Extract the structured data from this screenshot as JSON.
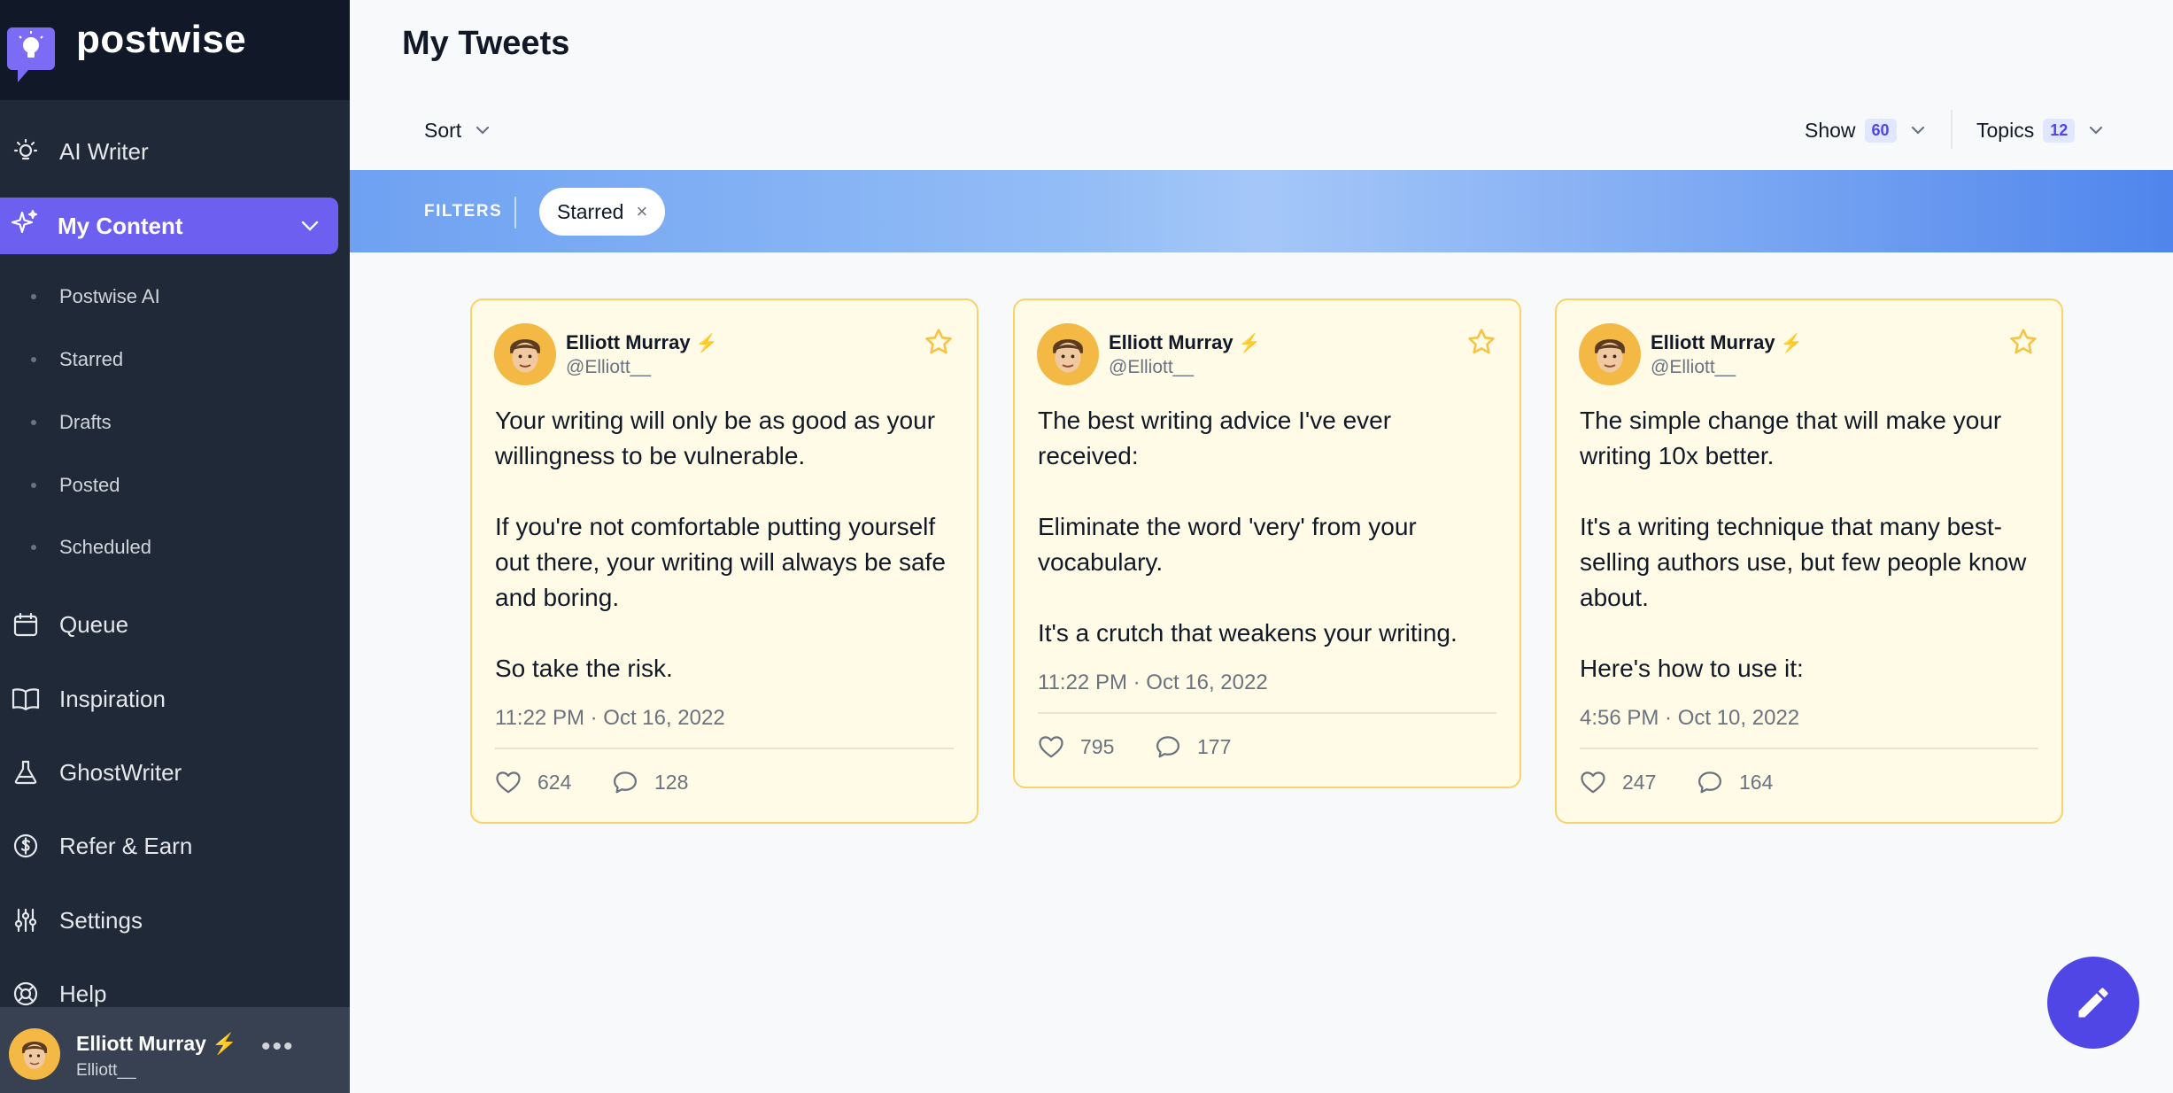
{
  "app": {
    "name": "postwise"
  },
  "sidebar": {
    "nav": [
      {
        "label": "AI Writer",
        "icon": "lightbulb-icon"
      },
      {
        "label": "My Content",
        "icon": "sparkles-icon",
        "active": true
      },
      {
        "label": "Queue",
        "icon": "calendar-icon"
      },
      {
        "label": "Inspiration",
        "icon": "book-icon"
      },
      {
        "label": "GhostWriter",
        "icon": "flask-icon"
      },
      {
        "label": "Refer & Earn",
        "icon": "dollar-icon"
      },
      {
        "label": "Settings",
        "icon": "sliders-icon"
      },
      {
        "label": "Help",
        "icon": "lifebuoy-icon"
      }
    ],
    "sub_items": [
      "Postwise AI",
      "Starred",
      "Drafts",
      "Posted",
      "Scheduled"
    ],
    "user": {
      "name": "Elliott Murray",
      "handle": "Elliott__",
      "more": "•••"
    }
  },
  "header": {
    "title": "My Tweets",
    "sort_label": "Sort",
    "show_label": "Show",
    "show_count": "60",
    "topics_label": "Topics",
    "topics_count": "12"
  },
  "filters": {
    "label": "FILTERS",
    "chips": [
      {
        "label": "Starred",
        "remove": "×"
      }
    ]
  },
  "tweets": [
    {
      "name": "Elliott Murray",
      "handle": "@Elliott__",
      "text": "Your writing will only be as good as your willingness to be vulnerable.\n\nIf you're not comfortable putting yourself out there, your writing will always be safe and boring.\n\nSo take the risk.",
      "timestamp": "11:22 PM · Oct 16, 2022",
      "likes": "624",
      "replies": "128"
    },
    {
      "name": "Elliott Murray",
      "handle": "@Elliott__",
      "text": "The best writing advice I've ever received:\n\nEliminate the word 'very' from your vocabulary.\n\nIt's a crutch that weakens your writing.",
      "timestamp": "11:22 PM · Oct 16, 2022",
      "likes": "795",
      "replies": "177"
    },
    {
      "name": "Elliott Murray",
      "handle": "@Elliott__",
      "text": "The simple change that will make your writing 10x better.\n\nIt's a writing technique that many best-selling authors use, but few people know about.\n\nHere's how to use it:",
      "timestamp": "4:56 PM · Oct 10, 2022",
      "likes": "247",
      "replies": "164"
    }
  ],
  "colors": {
    "sidebar_bg": "#1f2937",
    "accent": "#6d5ff0",
    "fab": "#4f46e5",
    "card_bg": "#fffbe6",
    "card_border": "#f7d36a"
  }
}
